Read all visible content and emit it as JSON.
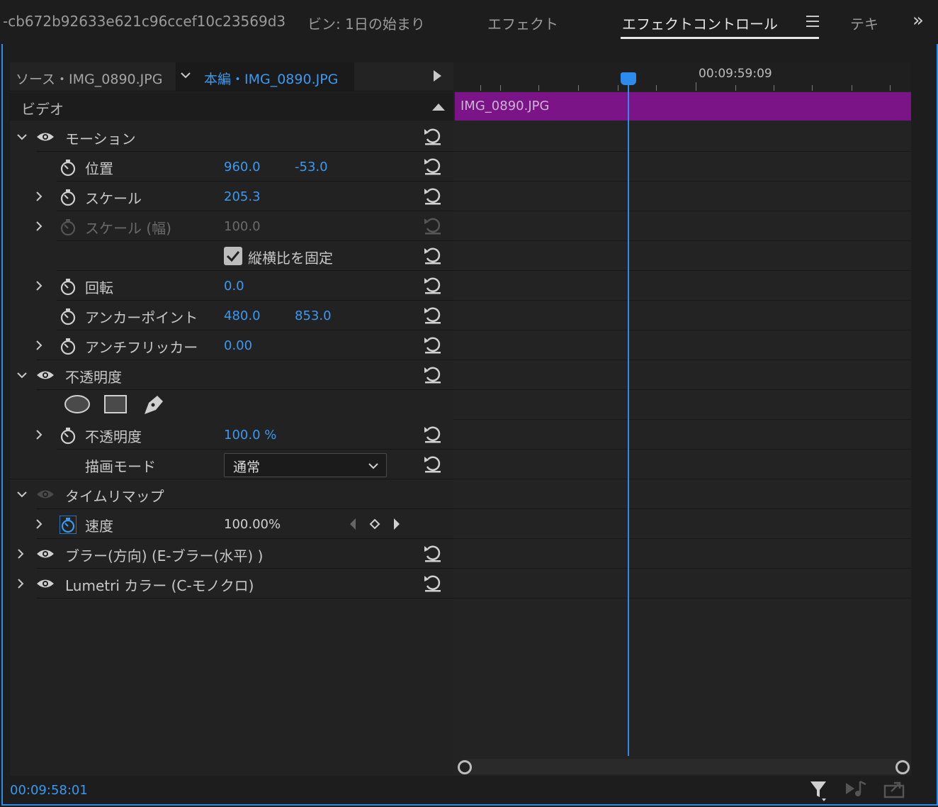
{
  "tabs": [
    {
      "label": "-cb672b92633e621c96ccef10c23569d3",
      "active": false
    },
    {
      "label": "ビン: 1日の始まり",
      "active": false
    },
    {
      "label": "エフェクト",
      "active": false
    },
    {
      "label": "エフェクトコントロール",
      "active": true
    },
    {
      "label": "テキ",
      "active": false
    }
  ],
  "source_bar": {
    "source": "ソース・IMG_0890.JPG",
    "sequence": "本編・IMG_0890.JPG"
  },
  "section_video": "ビデオ",
  "motion": {
    "label": "モーション",
    "position": {
      "label": "位置",
      "x": "960.0",
      "y": "-53.0"
    },
    "scale": {
      "label": "スケール",
      "value": "205.3"
    },
    "scale_width": {
      "label": "スケール (幅)",
      "value": "100.0"
    },
    "uniform_scale": {
      "label": "縦横比を固定",
      "checked": true
    },
    "rotation": {
      "label": "回転",
      "value": "0.0"
    },
    "anchor": {
      "label": "アンカーポイント",
      "x": "480.0",
      "y": "853.0"
    },
    "antiflicker": {
      "label": "アンチフリッカー",
      "value": "0.00"
    }
  },
  "opacity": {
    "label": "不透明度",
    "param_label": "不透明度",
    "value": "100.0 %",
    "blend_label": "描画モード",
    "blend_value": "通常"
  },
  "time_remap": {
    "label": "タイムリマップ",
    "speed_label": "速度",
    "speed_value": "100.00%"
  },
  "effects": [
    {
      "label": "ブラー(方向) (E-ブラー(水平) )"
    },
    {
      "label": "Lumetri カラー (C-モノクロ)"
    }
  ],
  "timeline": {
    "ruler_time": "00:09:59:09",
    "clip_name": "IMG_0890.JPG"
  },
  "current_timecode": "00:09:58:01",
  "colors": {
    "accent": "#2d8ceb",
    "value_blue": "#3b99f0",
    "clip_purple": "#7b1486"
  }
}
